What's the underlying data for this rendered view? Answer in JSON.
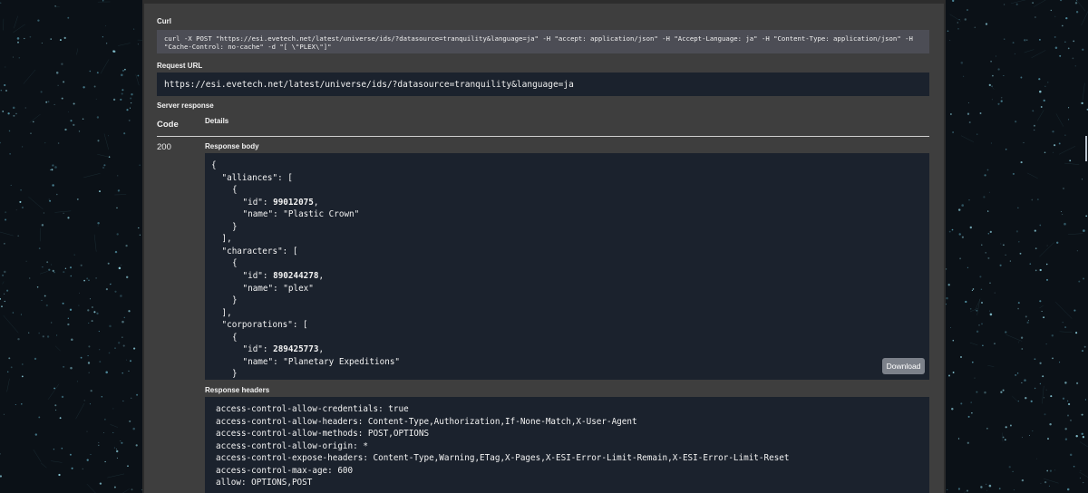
{
  "curl": {
    "label": "Curl",
    "command": "curl -X POST \"https://esi.evetech.net/latest/universe/ids/?datasource=tranquility&language=ja\" -H \"accept: application/json\" -H \"Accept-Language: ja\" -H \"Content-Type: application/json\" -H \"Cache-Control: no-cache\" -d \"[ \\\"PLEX\\\"]\""
  },
  "request_url": {
    "label": "Request URL",
    "value": "https://esi.evetech.net/latest/universe/ids/?datasource=tranquility&language=ja"
  },
  "server_response": {
    "label": "Server response",
    "code_header": "Code",
    "details_header": "Details",
    "code": "200"
  },
  "response_body": {
    "label": "Response body",
    "download_label": "Download",
    "lines": [
      {
        "indent": 0,
        "text": "{"
      },
      {
        "indent": 1,
        "text": "\"alliances\": ["
      },
      {
        "indent": 2,
        "text": "{"
      },
      {
        "indent": 3,
        "text": "\"id\": ",
        "num": "99012075",
        "tail": ","
      },
      {
        "indent": 3,
        "text": "\"name\": \"Plastic Crown\""
      },
      {
        "indent": 2,
        "text": "}"
      },
      {
        "indent": 1,
        "text": "],"
      },
      {
        "indent": 1,
        "text": "\"characters\": ["
      },
      {
        "indent": 2,
        "text": "{"
      },
      {
        "indent": 3,
        "text": "\"id\": ",
        "num": "890244278",
        "tail": ","
      },
      {
        "indent": 3,
        "text": "\"name\": \"plex\""
      },
      {
        "indent": 2,
        "text": "}"
      },
      {
        "indent": 1,
        "text": "],"
      },
      {
        "indent": 1,
        "text": "\"corporations\": ["
      },
      {
        "indent": 2,
        "text": "{"
      },
      {
        "indent": 3,
        "text": "\"id\": ",
        "num": "289425773",
        "tail": ","
      },
      {
        "indent": 3,
        "text": "\"name\": \"Planetary Expeditions\""
      },
      {
        "indent": 2,
        "text": "}"
      }
    ]
  },
  "response_headers": {
    "label": "Response headers",
    "lines": [
      "access-control-allow-credentials: true",
      "access-control-allow-headers: Content-Type,Authorization,If-None-Match,X-User-Agent",
      "access-control-allow-methods: POST,OPTIONS",
      "access-control-allow-origin: *",
      "access-control-expose-headers: Content-Type,Warning,ETag,X-Pages,X-ESI-Error-Limit-Remain,X-ESI-Error-Limit-Reset",
      "access-control-max-age: 600",
      "allow: OPTIONS,POST"
    ]
  },
  "colors": {
    "page_background": "#0b1117",
    "panel": "#3e3e3e",
    "code_block": "#1b222d",
    "curl_block": "#4c4d55",
    "button": "#7c818a"
  }
}
